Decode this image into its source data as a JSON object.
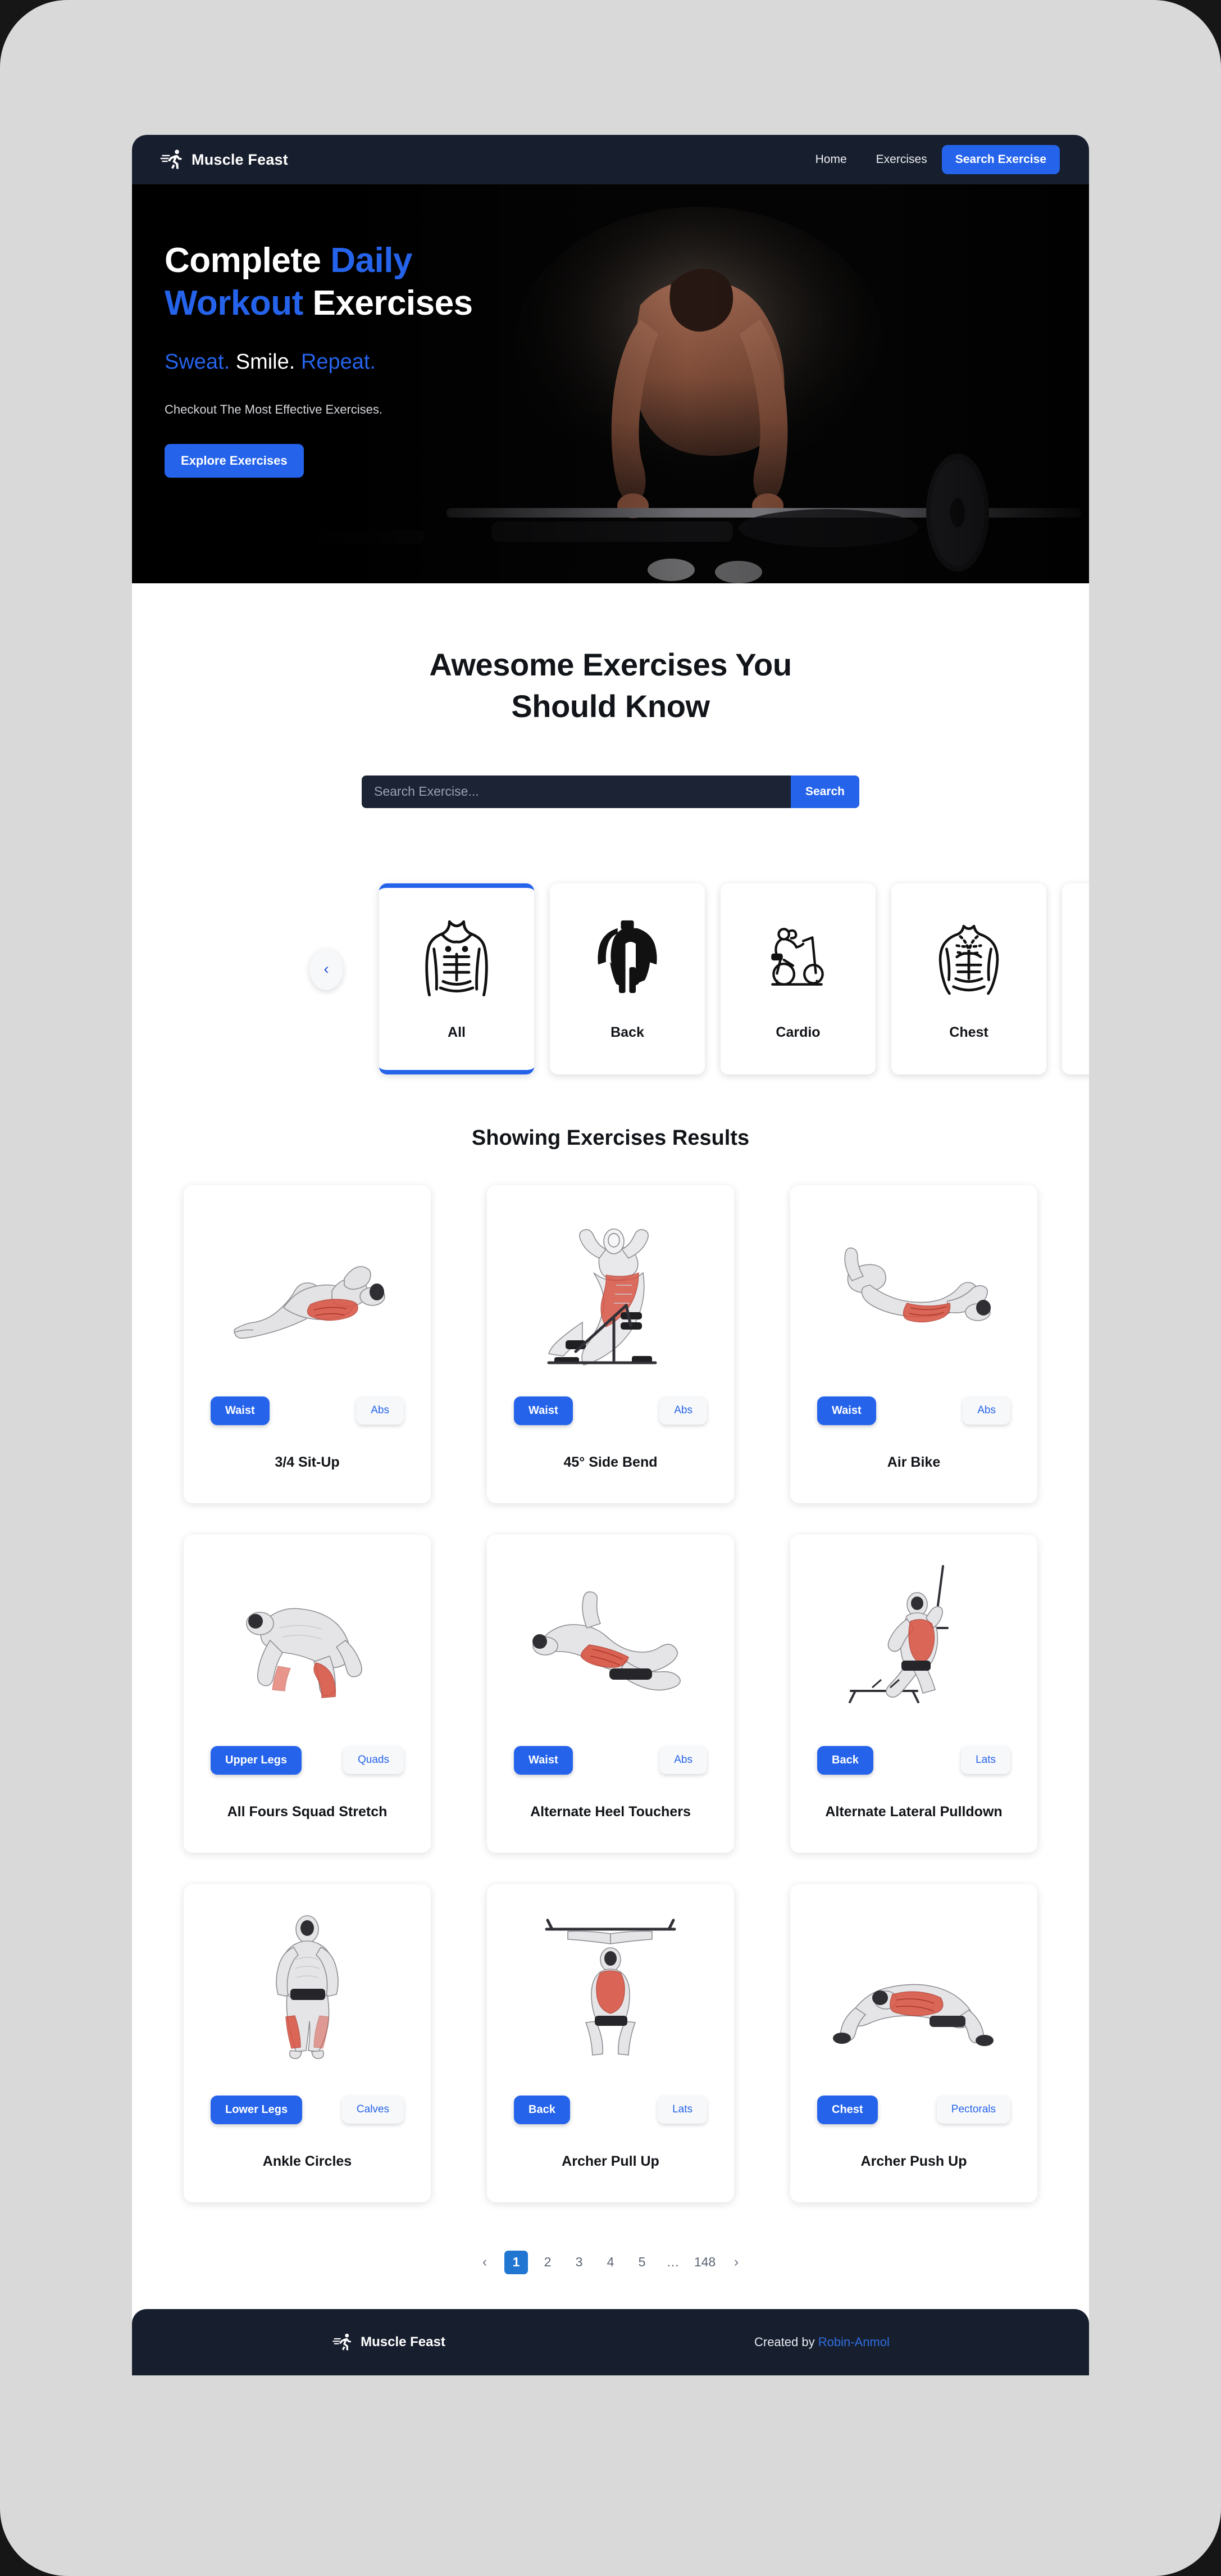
{
  "navbar": {
    "brand": "Muscle Feast",
    "brand_icon": "running-man-icon",
    "links": [
      {
        "label": "Home"
      },
      {
        "label": "Exercises"
      }
    ],
    "cta_label": "Search Exercise"
  },
  "hero": {
    "title_line1_a": "Complete ",
    "title_line1_b": "Daily",
    "title_line2_a": "Workout",
    "title_line2_b": " Exercises",
    "tag_a": "Sweat.",
    "tag_b": " Smile.",
    "tag_c": " Repeat.",
    "subtitle": "Checkout The Most Effective Exercises.",
    "button_label": "Explore Exercises",
    "background_image": "dark-gym-deadlift-photo"
  },
  "search": {
    "heading_line1": "Awesome Exercises You",
    "heading_line2": "Should Know",
    "placeholder": "Search Exercise...",
    "value": "",
    "button_label": "Search"
  },
  "carousel": {
    "prev_icon": "‹",
    "next_icon": "›",
    "categories": [
      {
        "label": "All",
        "icon": "torso-front-outline-icon",
        "active": true
      },
      {
        "label": "Back",
        "icon": "back-muscles-icon",
        "active": false
      },
      {
        "label": "Cardio",
        "icon": "exercise-bike-icon",
        "active": false
      },
      {
        "label": "Chest",
        "icon": "chest-muscles-icon",
        "active": false
      },
      {
        "label": "",
        "icon": "partial-card",
        "active": false
      }
    ]
  },
  "results": {
    "title": "Showing Exercises Results",
    "exercises": [
      {
        "name": "3/4 Sit-Up",
        "body_part": "Waist",
        "target": "Abs",
        "image": "situp-figure"
      },
      {
        "name": "45° Side Bend",
        "body_part": "Waist",
        "target": "Abs",
        "image": "side-bend-bench-figure"
      },
      {
        "name": "Air Bike",
        "body_part": "Waist",
        "target": "Abs",
        "image": "air-bike-figure"
      },
      {
        "name": "All Fours Squad Stretch",
        "body_part": "Upper Legs",
        "target": "Quads",
        "image": "all-fours-stretch-figure"
      },
      {
        "name": "Alternate Heel Touchers",
        "body_part": "Waist",
        "target": "Abs",
        "image": "heel-touchers-figure"
      },
      {
        "name": "Alternate Lateral Pulldown",
        "body_part": "Back",
        "target": "Lats",
        "image": "lateral-pulldown-figure"
      },
      {
        "name": "Ankle Circles",
        "body_part": "Lower Legs",
        "target": "Calves",
        "image": "ankle-circles-figure"
      },
      {
        "name": "Archer Pull Up",
        "body_part": "Back",
        "target": "Lats",
        "image": "archer-pullup-figure"
      },
      {
        "name": "Archer Push Up",
        "body_part": "Chest",
        "target": "Pectorals",
        "image": "archer-pushup-figure"
      }
    ]
  },
  "pagination": {
    "prev_icon": "‹",
    "next_icon": "›",
    "items": [
      "1",
      "2",
      "3",
      "4",
      "5",
      "…",
      "148"
    ],
    "current": "1"
  },
  "footer": {
    "brand": "Muscle Feast",
    "brand_icon": "running-man-icon",
    "credit_prefix": "Created by ",
    "credit_name": "Robin-Anmol"
  },
  "colors": {
    "accent": "#2563eb",
    "navbar_bg": "#171e2e",
    "page_bg": "#ffffff",
    "desktop_bg": "#d9d9d9",
    "muscle_highlight": "#d9503f"
  }
}
